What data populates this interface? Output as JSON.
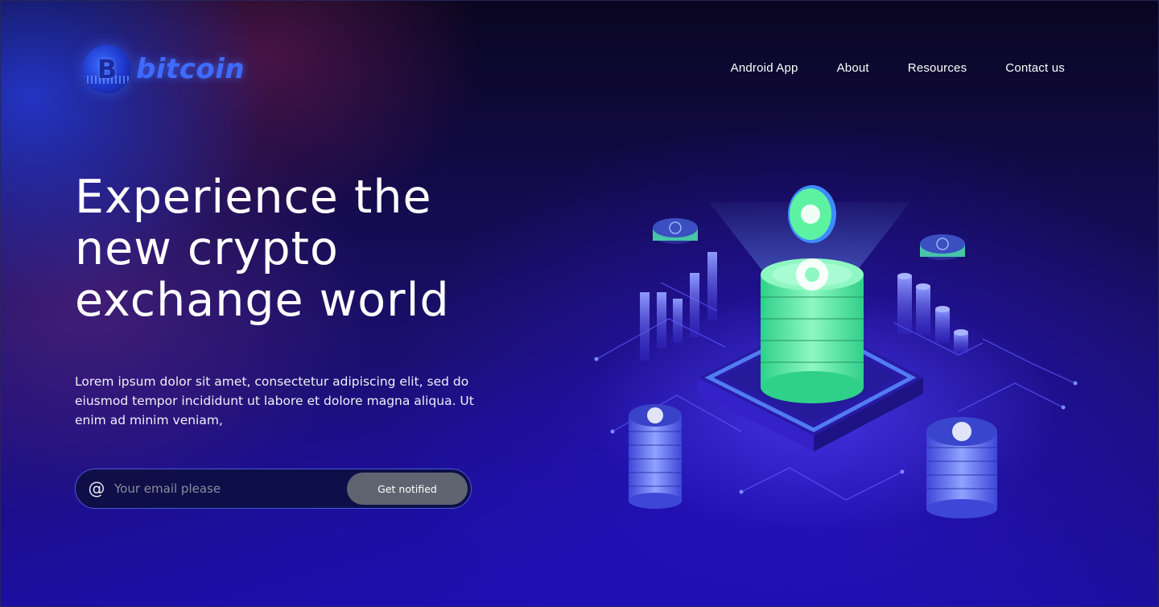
{
  "brand": {
    "name": "bitcoin",
    "mark": "B",
    "icon": "bitcoin-logo-icon",
    "color": "#3f6bff"
  },
  "nav": {
    "items": [
      {
        "label": "Android App"
      },
      {
        "label": "About"
      },
      {
        "label": "Resources"
      },
      {
        "label": "Contact us"
      }
    ]
  },
  "hero": {
    "title_lines": [
      "Experience the",
      "new crypto",
      "exchange world"
    ],
    "description": "Lorem ipsum dolor sit amet, consectetur adipiscing elit, sed do eiusmod tempor incididunt ut labore et dolore magna aliqua. Ut enim ad minim veniam,"
  },
  "signup": {
    "icon": "at-sign-icon",
    "at_symbol": "@",
    "placeholder": "Your email please",
    "value": "",
    "button_label": "Get notified"
  },
  "colors": {
    "accent_green": "#5cf2a2",
    "accent_blue": "#3f6bff",
    "button_gray": "#5e6571",
    "background_deep": "#1c0fa0"
  }
}
